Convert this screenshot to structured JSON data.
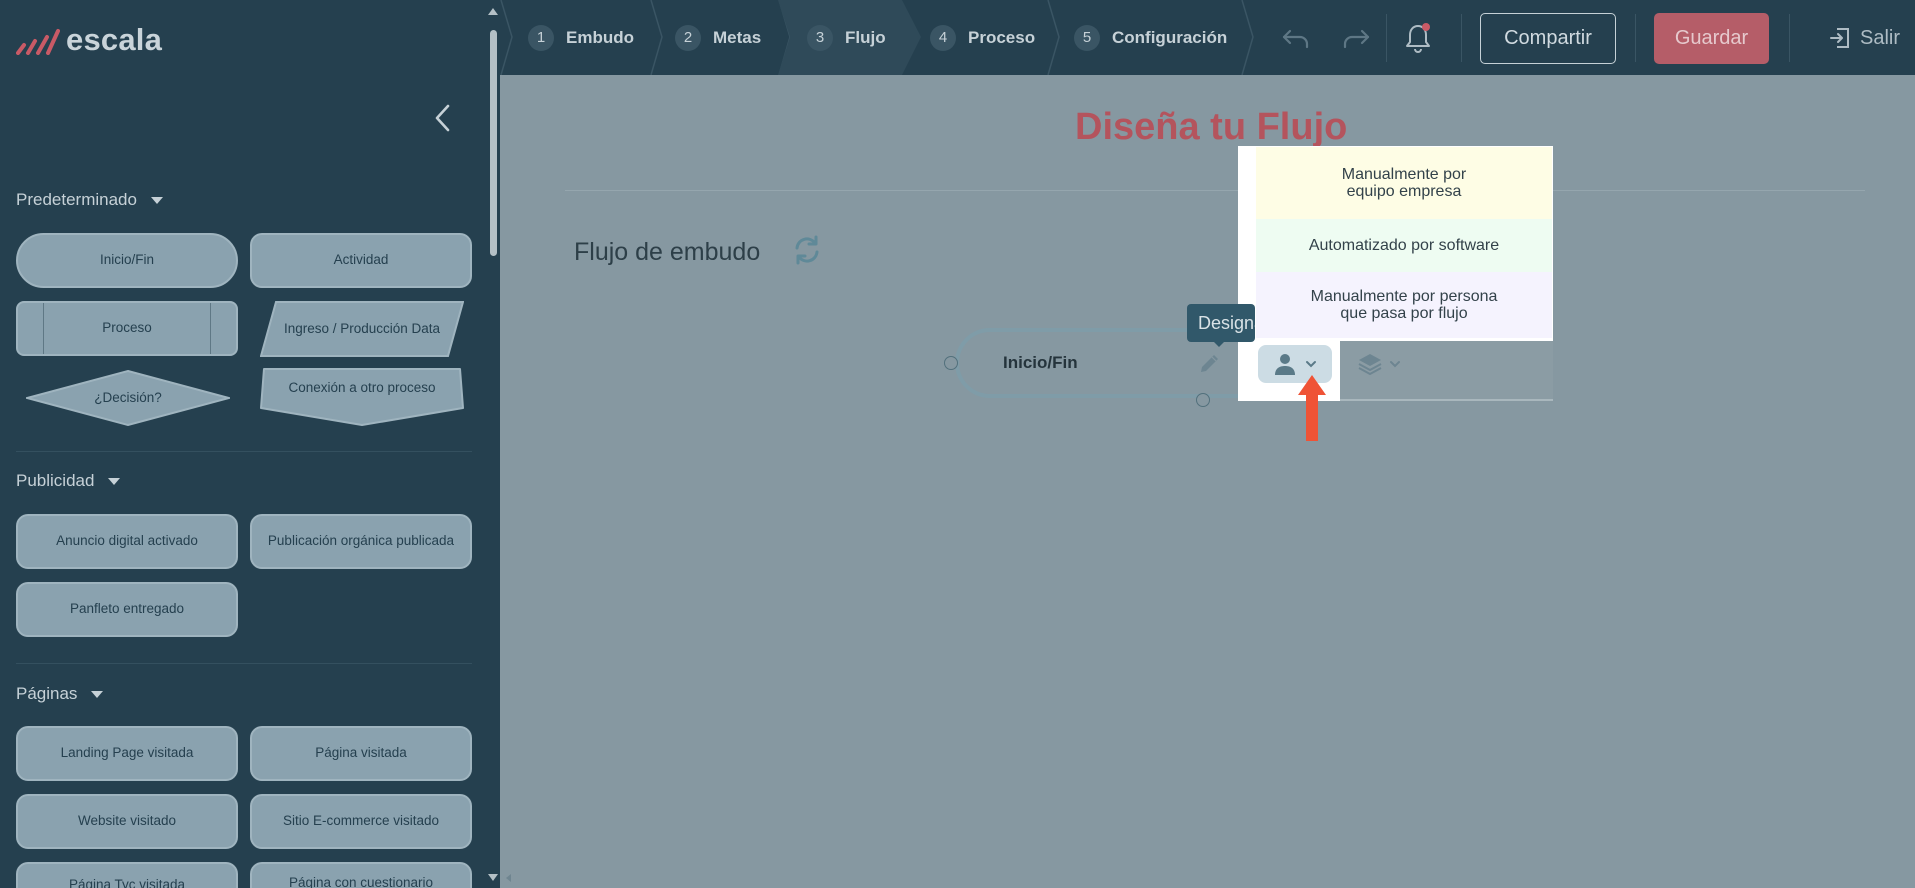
{
  "brand": {
    "name": "escala",
    "mark_color": "#c95a66"
  },
  "sidebar": {
    "sections": [
      {
        "title": "Predeterminado",
        "items": [
          "Inicio/Fin",
          "Actividad",
          "Proceso",
          "Ingreso / Producción Data",
          "¿Decisión?",
          "Conexión a otro proceso"
        ]
      },
      {
        "title": "Publicidad",
        "items": [
          "Anuncio digital activado",
          "Publicación orgánica publicada",
          "Panfleto entregado"
        ]
      },
      {
        "title": "Páginas",
        "items": [
          "Landing Page visitada",
          "Página visitada",
          "Website visitado",
          "Sitio E-commerce visitado",
          "Página Tyc visitada",
          "Página con cuestionario"
        ]
      }
    ]
  },
  "steps": [
    {
      "num": "1",
      "label": "Embudo"
    },
    {
      "num": "2",
      "label": "Metas"
    },
    {
      "num": "3",
      "label": "Flujo"
    },
    {
      "num": "4",
      "label": "Proceso"
    },
    {
      "num": "5",
      "label": "Configuración"
    }
  ],
  "active_step": 2,
  "toolbar": {
    "share_label": "Compartir",
    "save_label": "Guardar",
    "exit_label": "Salir"
  },
  "canvas": {
    "title": "Diseña tu Flujo",
    "funnel_title": "Flujo de embudo",
    "node_label": "Inicio/Fin",
    "tooltip": "Designar"
  },
  "dropdown": {
    "items": [
      {
        "line1": "Manualmente por",
        "line2": "equipo empresa"
      },
      {
        "line1": "Automatizado por software",
        "line2": ""
      },
      {
        "line1": "Manualmente por persona",
        "line2": "que pasa por flujo"
      }
    ]
  },
  "colors": {
    "sidebar_bg": "#25404f",
    "canvas_bg": "#8698a1",
    "accent_red": "#b4545d",
    "save_button": "#b55d68",
    "arrow": "#ef5336"
  }
}
